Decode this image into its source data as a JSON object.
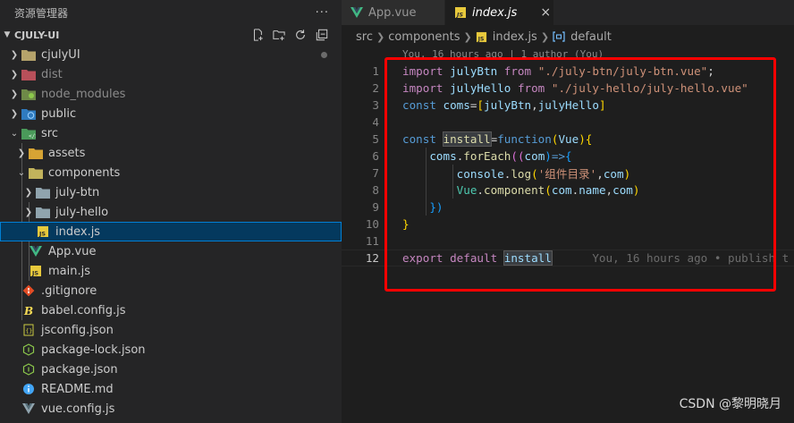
{
  "sidebar": {
    "title": "资源管理器",
    "more": "···",
    "section_title": "CJULY-UI",
    "tree": [
      {
        "label": "cjulyUI",
        "kind": "folder",
        "icon": "folder-ui-icon",
        "has_dot": true
      },
      {
        "label": "dist",
        "kind": "folder",
        "icon": "folder-dist-icon",
        "dim": true
      },
      {
        "label": "node_modules",
        "kind": "folder",
        "icon": "folder-node-icon",
        "dim": true
      },
      {
        "label": "public",
        "kind": "folder",
        "icon": "folder-public-icon"
      },
      {
        "label": "src",
        "kind": "folder-open",
        "icon": "folder-src-icon"
      },
      {
        "label": "assets",
        "kind": "folder",
        "icon": "folder-assets-icon"
      },
      {
        "label": "components",
        "kind": "folder-open",
        "icon": "folder-components-icon"
      },
      {
        "label": "july-btn",
        "kind": "folder",
        "icon": "folder-icon"
      },
      {
        "label": "july-hello",
        "kind": "folder",
        "icon": "folder-icon"
      },
      {
        "label": "index.js",
        "kind": "file",
        "icon": "js-file-icon",
        "selected": true
      },
      {
        "label": "App.vue",
        "kind": "file",
        "icon": "vue-file-icon"
      },
      {
        "label": "main.js",
        "kind": "file",
        "icon": "js-file-icon"
      },
      {
        "label": ".gitignore",
        "kind": "file",
        "icon": "git-file-icon"
      },
      {
        "label": "babel.config.js",
        "kind": "file",
        "icon": "babel-file-icon"
      },
      {
        "label": "jsconfig.json",
        "kind": "file",
        "icon": "json-file-icon"
      },
      {
        "label": "package-lock.json",
        "kind": "file",
        "icon": "npm-file-icon"
      },
      {
        "label": "package.json",
        "kind": "file",
        "icon": "npm-file-icon"
      },
      {
        "label": "README.md",
        "kind": "file",
        "icon": "info-file-icon"
      },
      {
        "label": "vue.config.js",
        "kind": "file",
        "icon": "vue-config-file-icon"
      }
    ]
  },
  "tabs": [
    {
      "label": "App.vue",
      "icon": "vue-file-icon",
      "active": false
    },
    {
      "label": "index.js",
      "icon": "js-file-icon",
      "active": true,
      "close": "×"
    }
  ],
  "breadcrumb": [
    "src",
    "components",
    "index.js",
    "default"
  ],
  "codelens": "You, 16 hours ago | 1 author (You)",
  "code": {
    "line_numbers": [
      "1",
      "2",
      "3",
      "4",
      "5",
      "6",
      "7",
      "8",
      "9",
      "10",
      "11",
      "12"
    ],
    "l1": {
      "kw": "import",
      "name": "julyBtn",
      "from": "from",
      "path": "\"./july-btn/july-btn.vue\"",
      "end": ";"
    },
    "l2": {
      "kw": "import",
      "name": "julyHello",
      "from": "from",
      "path": "\"./july-hello/july-hello.vue\""
    },
    "l3": {
      "kw": "const",
      "name": "coms",
      "eq": "=",
      "open": "[",
      "a": "julyBtn",
      "comma": ",",
      "b": "julyHello",
      "close": "]"
    },
    "l5": {
      "kw": "const",
      "name": "install",
      "eq": "=",
      "fn": "function",
      "open": "(",
      "param": "Vue",
      "close": ")",
      "brace": "{"
    },
    "l6": {
      "obj": "coms",
      "dot": ".",
      "method": "forEach",
      "open": "((",
      "param": "com",
      "close": ")",
      "arrow": "=>",
      "brace": "{"
    },
    "l7": {
      "obj": "console",
      "dot": ".",
      "method": "log",
      "open": "(",
      "str": "'组件目录'",
      "comma": ",",
      "arg": "com",
      "close": ")"
    },
    "l8": {
      "obj": "Vue",
      "dot": ".",
      "method": "component",
      "open": "(",
      "a": "com",
      "dot2": ".",
      "prop": "name",
      "comma": ",",
      "b": "com",
      "close": ")"
    },
    "l9": {
      "text": "})"
    },
    "l10": {
      "text": "}"
    },
    "l12": {
      "kw1": "export",
      "kw2": "default",
      "name": "install",
      "blame": "You, 16 hours ago • publish t"
    }
  },
  "watermark": "CSDN @黎明晓月",
  "colors": {
    "highlight_box": "#ff0000",
    "selection": "#04395e"
  }
}
